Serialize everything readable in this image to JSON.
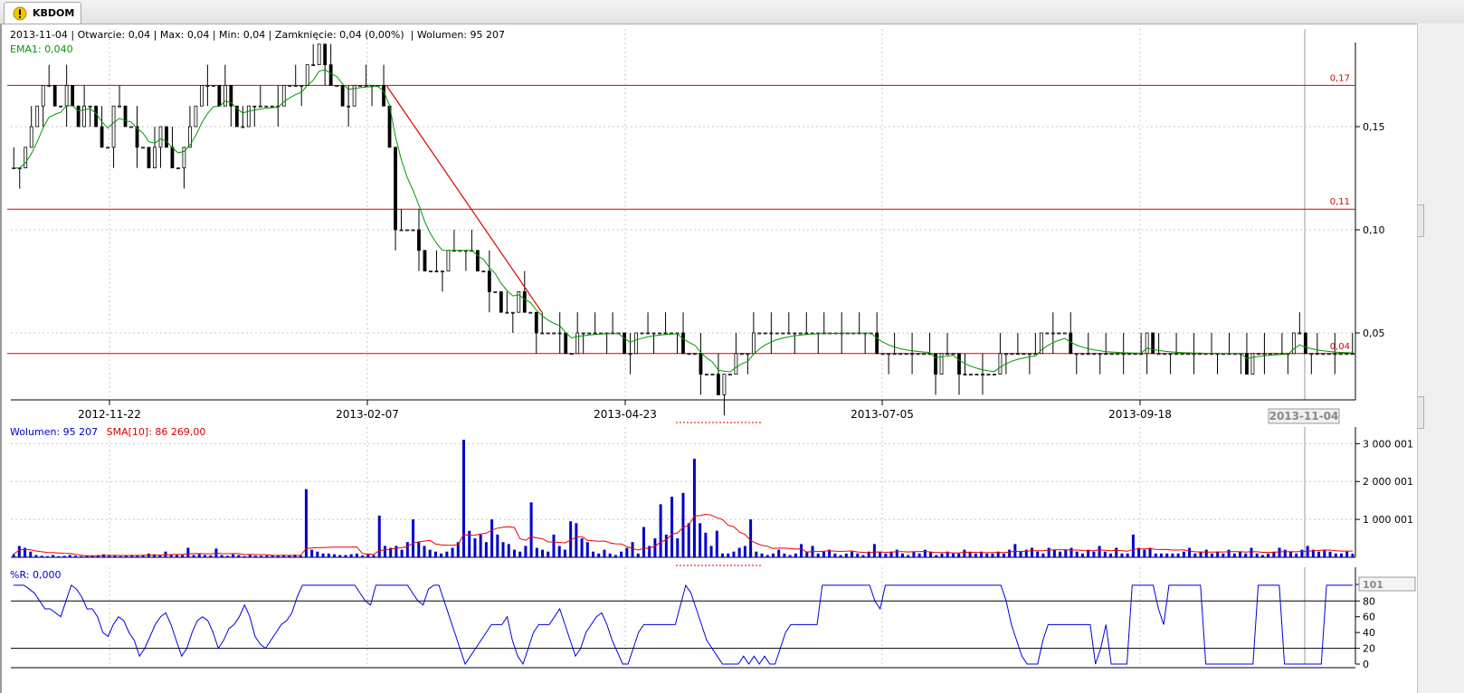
{
  "tab": {
    "label": "KBDOM",
    "icon": "warning-icon"
  },
  "info_line": "2013-11-04 | Otwarcie: 0,04 | Max: 0,04 | Min: 0,04 | Zamknięcie: 0,04 (0,00%)  | Wolumen: 95 207",
  "ema_label": "EMA1: 0,040",
  "volume_legend": {
    "volume": "Wolumen: 95 207",
    "sma": "SMA[10]: 86 269,00"
  },
  "wr_label": "%R: 0,000",
  "colors": {
    "candle": "#000000",
    "ema": "#009900",
    "hline": "#dd0000",
    "trendline": "#dd0000",
    "volume": "#0000cc",
    "sma": "#ee0000",
    "wr": "#0000dd",
    "grid": "#c8c8c8"
  },
  "chart_data": [
    {
      "type": "candlestick",
      "xlabel": "",
      "ylabel": "",
      "x_tick_labels": [
        "2012-11-22",
        "2013-02-07",
        "2013-04-23",
        "2013-07-05",
        "2013-09-18"
      ],
      "highlighted_date": "2013-11-04",
      "y_ticks": [
        0.05,
        0.1,
        0.15
      ],
      "y_tick_labels": [
        "0,05",
        "0,10",
        "0,15"
      ],
      "ylim": [
        0.02,
        0.19
      ],
      "horizontal_lines": [
        {
          "value": 0.17,
          "label": "0,17"
        },
        {
          "value": 0.11,
          "label": "0,11"
        },
        {
          "value": 0.04,
          "label": "0,04"
        }
      ],
      "trendline": {
        "from": {
          "date": "2013-02-07",
          "value": 0.17
        },
        "to": {
          "date": "2013-04-06",
          "value": 0.06
        }
      },
      "close_series": [
        0.13,
        0.13,
        0.14,
        0.15,
        0.16,
        0.17,
        0.17,
        0.16,
        0.16,
        0.17,
        0.16,
        0.15,
        0.16,
        0.16,
        0.15,
        0.14,
        0.14,
        0.16,
        0.16,
        0.15,
        0.15,
        0.14,
        0.14,
        0.13,
        0.14,
        0.15,
        0.14,
        0.13,
        0.13,
        0.14,
        0.15,
        0.16,
        0.17,
        0.17,
        0.17,
        0.16,
        0.17,
        0.16,
        0.15,
        0.15,
        0.16,
        0.16,
        0.16,
        0.16,
        0.16,
        0.16,
        0.17,
        0.17,
        0.17,
        0.17,
        0.18,
        0.18,
        0.19,
        0.18,
        0.17,
        0.17,
        0.16,
        0.16,
        0.17,
        0.17,
        0.17,
        0.17,
        0.17,
        0.16,
        0.14,
        0.1,
        0.1,
        0.1,
        0.1,
        0.09,
        0.08,
        0.08,
        0.08,
        0.08,
        0.09,
        0.09,
        0.09,
        0.09,
        0.09,
        0.08,
        0.08,
        0.07,
        0.07,
        0.06,
        0.06,
        0.06,
        0.07,
        0.06,
        0.06,
        0.05,
        0.05,
        0.05,
        0.05,
        0.05,
        0.04,
        0.04,
        0.05,
        0.05,
        0.05,
        0.05,
        0.05,
        0.05,
        0.05,
        0.05,
        0.04,
        0.04,
        0.05,
        0.05,
        0.05,
        0.05,
        0.05,
        0.05,
        0.05,
        0.05,
        0.04,
        0.04,
        0.04,
        0.03,
        0.03,
        0.03,
        0.02,
        0.03,
        0.03,
        0.04,
        0.04,
        0.04,
        0.05,
        0.05,
        0.05,
        0.05,
        0.05,
        0.05,
        0.05,
        0.05,
        0.05,
        0.05,
        0.05,
        0.05,
        0.05,
        0.05,
        0.05,
        0.05,
        0.05,
        0.05,
        0.05,
        0.05,
        0.05,
        0.04,
        0.04,
        0.04,
        0.04,
        0.04,
        0.04,
        0.04,
        0.04,
        0.04,
        0.04,
        0.03,
        0.04,
        0.04,
        0.04,
        0.03,
        0.03,
        0.03,
        0.03,
        0.03,
        0.03,
        0.03,
        0.04,
        0.04,
        0.04,
        0.04,
        0.04,
        0.04,
        0.04,
        0.05,
        0.05,
        0.05,
        0.05,
        0.05,
        0.04,
        0.04,
        0.04,
        0.04,
        0.04,
        0.04,
        0.04,
        0.04,
        0.04,
        0.04,
        0.04,
        0.04,
        0.04,
        0.05,
        0.04,
        0.04,
        0.04,
        0.04,
        0.04,
        0.04,
        0.04,
        0.04,
        0.04,
        0.04,
        0.04,
        0.04,
        0.04,
        0.04,
        0.04,
        0.04,
        0.03,
        0.04,
        0.04,
        0.04,
        0.04,
        0.04,
        0.04,
        0.04,
        0.05,
        0.05,
        0.04,
        0.04,
        0.04,
        0.04,
        0.04,
        0.04,
        0.04,
        0.04,
        0.04
      ],
      "ema_series_name": "EMA1"
    },
    {
      "type": "bar",
      "series": [
        {
          "name": "Wolumen",
          "values": [
            80000,
            300000,
            250000,
            150000,
            60000,
            40000,
            30000,
            60000,
            30000,
            40000,
            60000,
            40000,
            30000,
            50000,
            40000,
            60000,
            80000,
            60000,
            40000,
            30000,
            50000,
            60000,
            40000,
            60000,
            100000,
            80000,
            60000,
            150000,
            80000,
            60000,
            60000,
            250000,
            60000,
            80000,
            60000,
            50000,
            230000,
            60000,
            40000,
            80000,
            60000,
            30000,
            60000,
            40000,
            40000,
            50000,
            60000,
            40000,
            60000,
            60000,
            70000,
            50000,
            1800000,
            200000,
            150000,
            100000,
            100000,
            80000,
            60000,
            60000,
            80000,
            100000,
            50000,
            80000,
            60000,
            1100000,
            300000,
            250000,
            300000,
            200000,
            400000,
            1000000,
            400000,
            300000,
            200000,
            150000,
            100000,
            150000,
            250000,
            400000,
            3100000,
            700000,
            500000,
            600000,
            400000,
            1000000,
            600000,
            400000,
            350000,
            200000,
            150000,
            300000,
            1450000,
            250000,
            200000,
            150000,
            600000,
            300000,
            200000,
            950000,
            900000,
            500000,
            400000,
            150000,
            100000,
            200000,
            100000,
            60000,
            150000,
            250000,
            400000,
            100000,
            800000,
            300000,
            500000,
            1400000,
            600000,
            1600000,
            500000,
            1700000,
            900000,
            2600000,
            900000,
            650000,
            300000,
            700000,
            100000,
            100000,
            150000,
            250000,
            300000,
            1000000,
            150000,
            100000,
            60000,
            100000,
            200000,
            100000,
            60000,
            100000,
            350000,
            150000,
            300000,
            100000,
            150000,
            200000,
            100000,
            60000,
            100000,
            150000,
            100000,
            60000,
            150000,
            350000,
            150000,
            100000,
            150000,
            200000,
            100000,
            60000,
            150000,
            100000,
            200000,
            150000,
            60000,
            100000,
            150000,
            100000,
            100000,
            200000,
            150000,
            100000,
            150000,
            100000,
            100000,
            150000,
            100000,
            200000,
            350000,
            150000,
            200000,
            250000,
            150000,
            100000,
            250000,
            200000,
            150000,
            200000,
            250000,
            150000,
            100000,
            200000,
            150000,
            300000,
            150000,
            100000,
            250000,
            100000,
            100000,
            600000,
            250000,
            200000,
            250000,
            100000,
            100000,
            100000,
            100000,
            100000,
            150000,
            250000,
            100000,
            150000,
            200000,
            100000,
            150000,
            100000,
            200000,
            100000,
            150000,
            100000,
            250000,
            100000,
            60000,
            100000,
            150000,
            250000,
            200000,
            150000,
            100000,
            200000,
            300000,
            200000,
            150000,
            200000,
            150000,
            100000,
            100000,
            150000,
            95207
          ]
        },
        {
          "name": "SMA[10]",
          "type": "line"
        }
      ],
      "y_ticks": [
        1000001,
        2000001,
        3000001
      ],
      "y_tick_labels": [
        "1 000 001",
        "2 000 001",
        "3 000 001"
      ],
      "ylim": [
        0,
        3200000
      ]
    },
    {
      "type": "line",
      "series": [
        {
          "name": "%R",
          "values": [
            100,
            100,
            100,
            95,
            90,
            80,
            70,
            70,
            65,
            60,
            80,
            100,
            95,
            85,
            70,
            70,
            60,
            40,
            35,
            50,
            60,
            55,
            40,
            30,
            10,
            20,
            35,
            50,
            60,
            65,
            50,
            30,
            10,
            20,
            40,
            55,
            60,
            55,
            40,
            20,
            30,
            45,
            50,
            60,
            75,
            60,
            35,
            25,
            20,
            30,
            40,
            50,
            55,
            65,
            85,
            100,
            100,
            100,
            100,
            100,
            100,
            100,
            100,
            100,
            100,
            100,
            90,
            80,
            75,
            100,
            100,
            100,
            100,
            100,
            100,
            100,
            90,
            80,
            75,
            95,
            100,
            100,
            80,
            60,
            40,
            20,
            0,
            10,
            20,
            30,
            40,
            50,
            50,
            50,
            60,
            30,
            10,
            0,
            20,
            40,
            50,
            50,
            50,
            60,
            70,
            50,
            30,
            10,
            20,
            40,
            50,
            60,
            65,
            50,
            30,
            15,
            0,
            0,
            20,
            40,
            50,
            50,
            50,
            50,
            50,
            50,
            50,
            75,
            100,
            90,
            70,
            50,
            30,
            20,
            10,
            0,
            0,
            0,
            0,
            10,
            0,
            10,
            0,
            10,
            0,
            0,
            20,
            40,
            50,
            50,
            50,
            50,
            50,
            50,
            100,
            100,
            100,
            100,
            100,
            100,
            100,
            100,
            100,
            100,
            80,
            70,
            100,
            100,
            100,
            100,
            100,
            100,
            100,
            100,
            100,
            100,
            100,
            100,
            100,
            100,
            100,
            100,
            100,
            100,
            100,
            100,
            100,
            100,
            100,
            80,
            50,
            30,
            10,
            0,
            0,
            0,
            30,
            50,
            50,
            50,
            50,
            50,
            50,
            50,
            50,
            50,
            0,
            20,
            50,
            0,
            0,
            0,
            0,
            100,
            100,
            100,
            100,
            100,
            70,
            50,
            100,
            100,
            100,
            100,
            100,
            100,
            100,
            0,
            0,
            0,
            0,
            0,
            0,
            0,
            0,
            0,
            0,
            100,
            100,
            100,
            100,
            100,
            0,
            0,
            0,
            0,
            0,
            0,
            0,
            0,
            100,
            100,
            100,
            100,
            100,
            100
          ]
        }
      ],
      "y_ticks": [
        0,
        20,
        40,
        60,
        80,
        101
      ],
      "y_tick_labels": [
        "0",
        "20",
        "40",
        "60",
        "80",
        "101"
      ],
      "reference_lines": [
        20,
        80
      ],
      "ylim": [
        0,
        101
      ]
    }
  ]
}
